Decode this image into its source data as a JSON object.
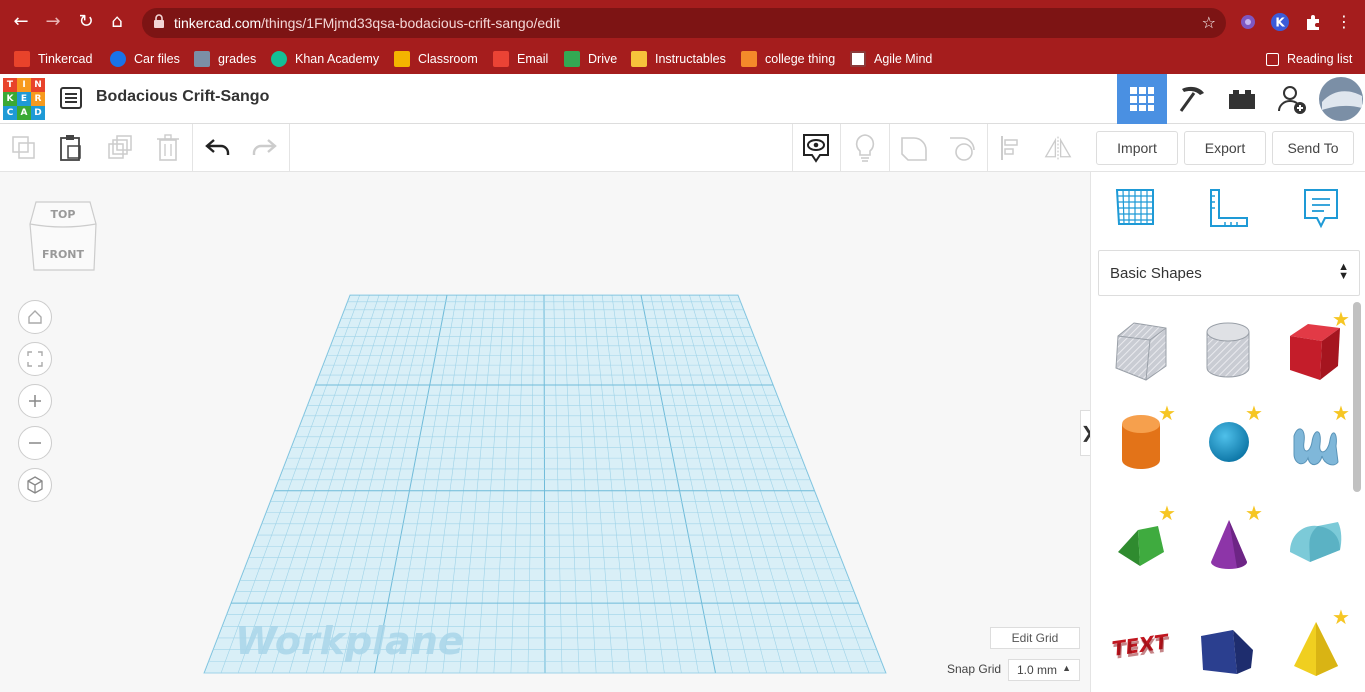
{
  "browser": {
    "url_domain": "tinkercad.com",
    "url_path": "/things/1FMjmd33qsa-bodacious-crift-sango/edit",
    "bookmarks": [
      {
        "label": "Tinkercad",
        "color": "#e8432b"
      },
      {
        "label": "Car files",
        "color": "#1a73e8"
      },
      {
        "label": "grades",
        "color": "#7b8fa6"
      },
      {
        "label": "Khan Academy",
        "color": "#14bf96"
      },
      {
        "label": "Classroom",
        "color": "#f4b400"
      },
      {
        "label": "Email",
        "color": "#ea4335"
      },
      {
        "label": "Drive",
        "color": "#34a853"
      },
      {
        "label": "Instructables",
        "color": "#f7c23b"
      },
      {
        "label": "college thing",
        "color": "#f48a2a"
      },
      {
        "label": "Agile Mind",
        "color": "#8a3b3b"
      }
    ],
    "reading_list": "Reading list"
  },
  "app": {
    "logo_letters": [
      "T",
      "I",
      "N",
      "K",
      "E",
      "R",
      "C",
      "A",
      "D"
    ],
    "design_title": "Bodacious Crift-Sango"
  },
  "toolbar": {
    "import_label": "Import",
    "export_label": "Export",
    "send_to_label": "Send To"
  },
  "workspace": {
    "viewcube_top": "TOP",
    "viewcube_front": "FRONT",
    "workplane_label": "Workplane",
    "edit_grid_label": "Edit Grid",
    "snap_grid_label": "Snap Grid",
    "snap_grid_value": "1.0 mm",
    "collapse_glyph": "❯"
  },
  "panel": {
    "shape_category": "Basic Shapes",
    "shapes": [
      {
        "name": "box-hole",
        "favorite": false
      },
      {
        "name": "cylinder-hole",
        "favorite": false
      },
      {
        "name": "box",
        "favorite": true
      },
      {
        "name": "cylinder",
        "favorite": true
      },
      {
        "name": "sphere",
        "favorite": true
      },
      {
        "name": "scribble",
        "favorite": true
      },
      {
        "name": "roof",
        "favorite": true
      },
      {
        "name": "cone",
        "favorite": true
      },
      {
        "name": "round-roof",
        "favorite": false
      },
      {
        "name": "text",
        "favorite": false
      },
      {
        "name": "wedge",
        "favorite": false
      },
      {
        "name": "pyramid",
        "favorite": true
      }
    ]
  }
}
